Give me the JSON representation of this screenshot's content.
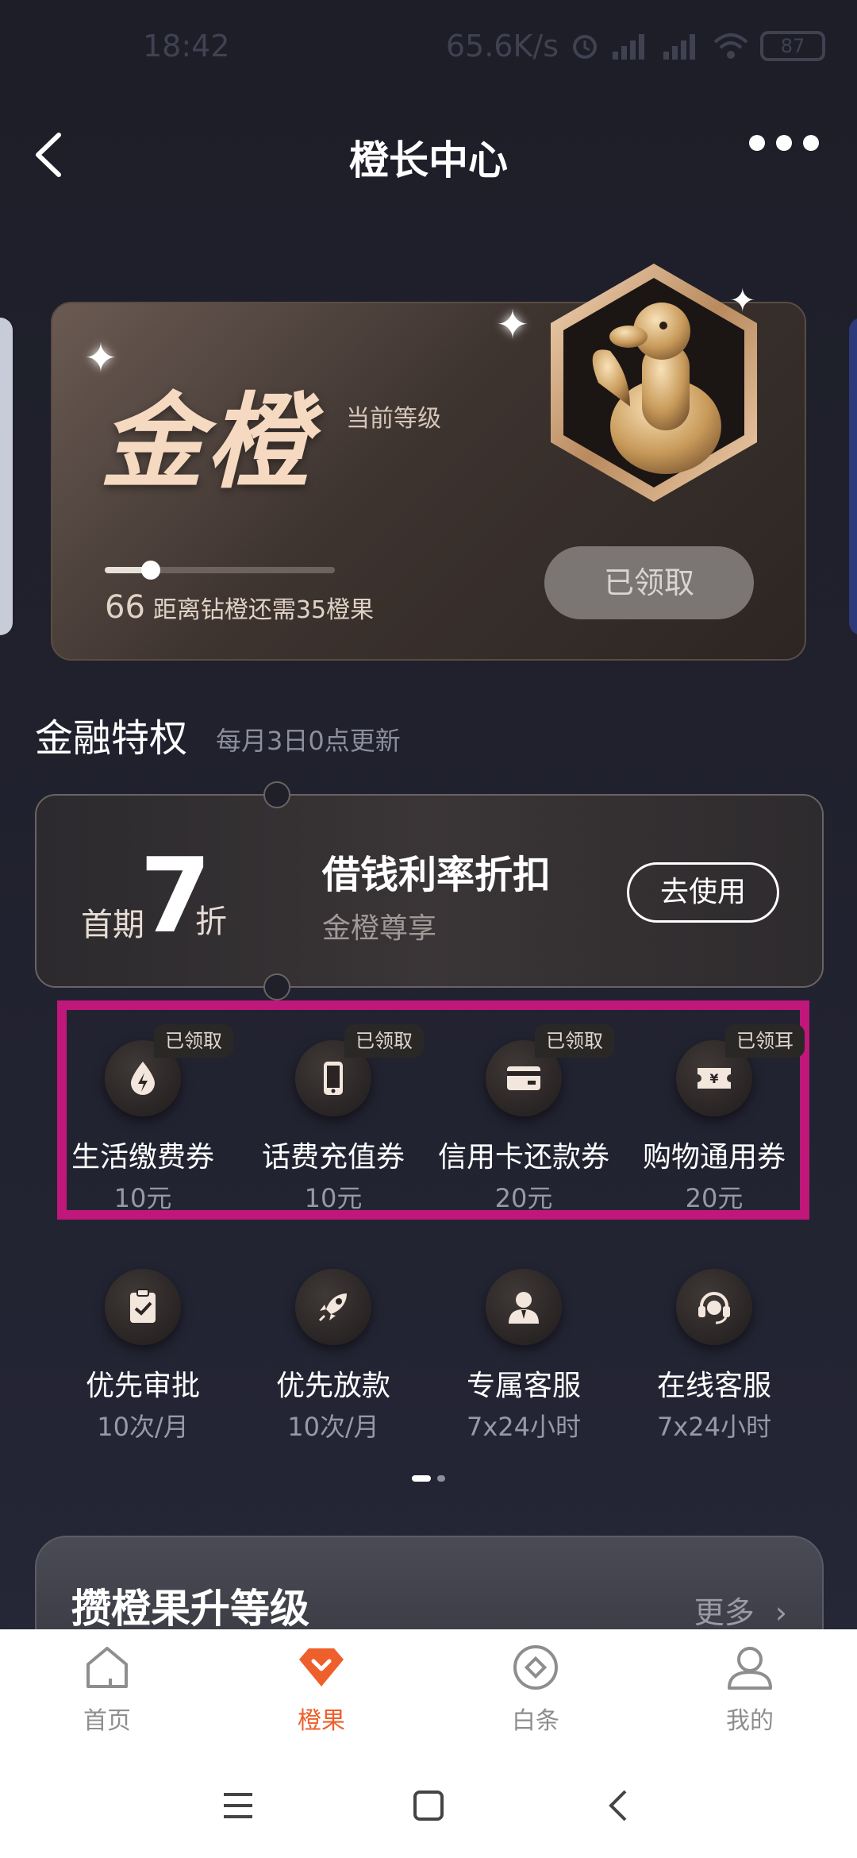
{
  "status_bar": {
    "time": "18:42",
    "net_speed": "65.6K/s",
    "battery": "87"
  },
  "nav": {
    "title": "橙长中心"
  },
  "level_card": {
    "level_name": "金橙",
    "level_sub": "当前等级",
    "progress_value": "66",
    "progress_text": "距离钻橙还需35橙果",
    "progress_fraction": 0.2,
    "claimed_label": "已领取"
  },
  "finance": {
    "title": "金融特权",
    "subtitle": "每月3日0点更新"
  },
  "coupon": {
    "prefix": "首期",
    "number": "7",
    "suffix": "折",
    "title": "借钱利率折扣",
    "subtitle": "金橙尊享",
    "button": "去使用"
  },
  "vouchers": [
    {
      "tag": "已领取",
      "label": "生活缴费券",
      "value": "10元",
      "icon": "lightning-icon"
    },
    {
      "tag": "已领取",
      "label": "话费充值券",
      "value": "10元",
      "icon": "phone-icon"
    },
    {
      "tag": "已领取",
      "label": "信用卡还款券",
      "value": "20元",
      "icon": "credit-card-icon"
    },
    {
      "tag": "已领耳",
      "label": "购物通用券",
      "value": "20元",
      "icon": "yen-ticket-icon"
    }
  ],
  "services": [
    {
      "label": "优先审批",
      "value": "10次/月",
      "icon": "clipboard-check-icon"
    },
    {
      "label": "优先放款",
      "value": "10次/月",
      "icon": "rocket-icon"
    },
    {
      "label": "专属客服",
      "value": "7x24小时",
      "icon": "person-icon"
    },
    {
      "label": "在线客服",
      "value": "7x24小时",
      "icon": "headset-icon"
    }
  ],
  "upgrade": {
    "title": "攒橙果升等级",
    "more": "更多"
  },
  "tabs": [
    {
      "label": "首页",
      "icon": "home-icon"
    },
    {
      "label": "橙果",
      "icon": "orange-gem-icon"
    },
    {
      "label": "白条",
      "icon": "diamond-circle-icon"
    },
    {
      "label": "我的",
      "icon": "user-icon"
    }
  ],
  "colors": {
    "accent": "#ef5f2b",
    "highlight": "#c0177b",
    "gold": "#f5d9c0"
  }
}
